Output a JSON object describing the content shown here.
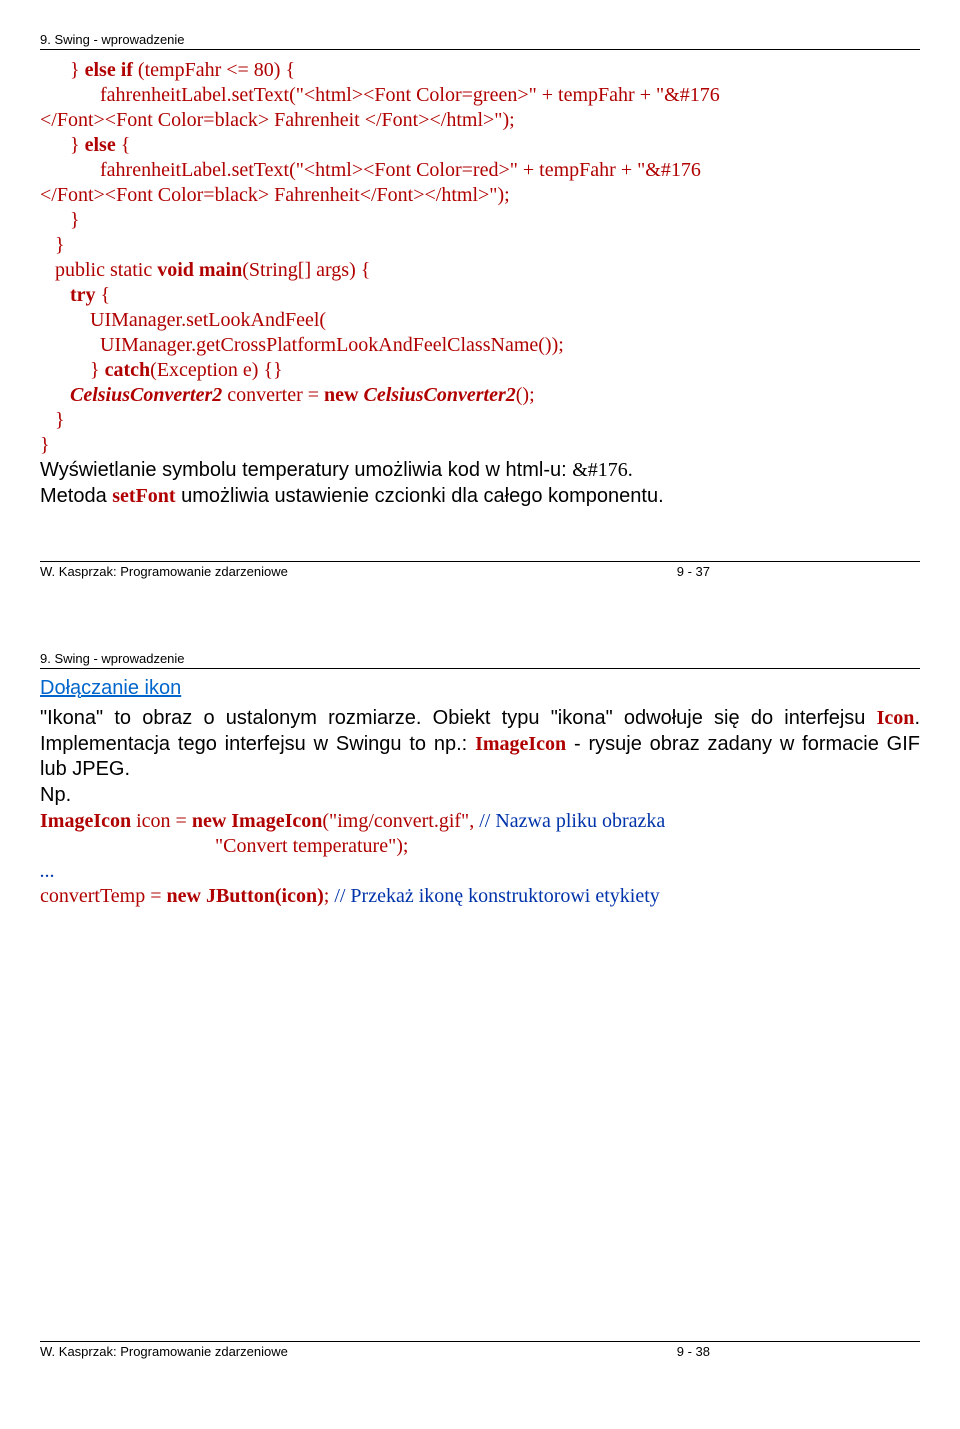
{
  "page1": {
    "header": "9. Swing - wprowadzenie",
    "code_l1a": "      } ",
    "code_l1b": "else if",
    "code_l1c": " (tempFahr <= 80) {",
    "code_l2": "            fahrenheitLabel.setText(\"<html><Font Color=green>\" + tempFahr + \"&#176",
    "code_l3": "</Font><Font Color=black> Fahrenheit </Font></html>\");",
    "code_l4a": "      } ",
    "code_l4b": "else",
    "code_l4c": " {",
    "code_l5": "            fahrenheitLabel.setText(\"<html><Font Color=red>\" + tempFahr + \"&#176",
    "code_l6": "</Font><Font Color=black> Fahrenheit</Font></html>\");",
    "code_l7": "      }",
    "code_l8": "   }",
    "code_l9a": "   public static ",
    "code_l9b": "void main",
    "code_l9c": "(String[] args) {",
    "code_l10a": "      ",
    "code_l10b": "try",
    "code_l10c": " {",
    "code_l11": "          UIManager.setLookAndFeel(",
    "code_l12": "            UIManager.getCrossPlatformLookAndFeelClassName());",
    "code_l13a": "          } ",
    "code_l13b": "catch",
    "code_l13c": "(Exception e) {}",
    "code_l14a": "      ",
    "code_l14b": "CelsiusConverter2",
    "code_l14c": " converter = ",
    "code_l14d": "new",
    "code_l14e": " ",
    "code_l14f": "CelsiusConverter2",
    "code_l14g": "();",
    "code_l15": "   }",
    "code_l16": "}",
    "para1a": "Wyświetlanie symbolu temperatury umożliwia kod w html-u:  ",
    "para1b": "&#176.",
    "para2a": "Metoda ",
    "para2b": "setFont",
    "para2c": " umożliwia ustawienie czcionki dla całego komponentu.",
    "footer_left": "W. Kasprzak: Programowanie zdarzeniowe",
    "footer_right": "9 - 37"
  },
  "page2": {
    "header": "9. Swing - wprowadzenie",
    "section": "Dołączanie ikon",
    "para1a": "\"Ikona\" to obraz o ustalonym rozmiarze. Obiekt typu \"ikona\" odwołuje się do interfejsu ",
    "para1b": "Icon",
    "para1c": ". Implementacja tego interfejsu w Swingu to np.: ",
    "para1d": "ImageIcon",
    "para1e": " - rysuje obraz zadany w formacie GIF lub JPEG.",
    "para2": "Np.",
    "code_l1a": "ImageIcon",
    "code_l1b": " icon = ",
    "code_l1c": "new ImageIcon",
    "code_l1d": "(\"img/convert.gif\", ",
    "code_l1e": "// Nazwa pliku obrazka",
    "code_l2a": "                                   \"Convert temperature\");",
    "code_l3": "...",
    "code_l4a": "convertTemp = ",
    "code_l4b": "new JButton(icon)",
    "code_l4c": "; ",
    "code_l4d": "// Przekaż ikonę konstruktorowi etykiety",
    "footer_left": "W. Kasprzak: Programowanie zdarzeniowe",
    "footer_right": "9 - 38"
  }
}
